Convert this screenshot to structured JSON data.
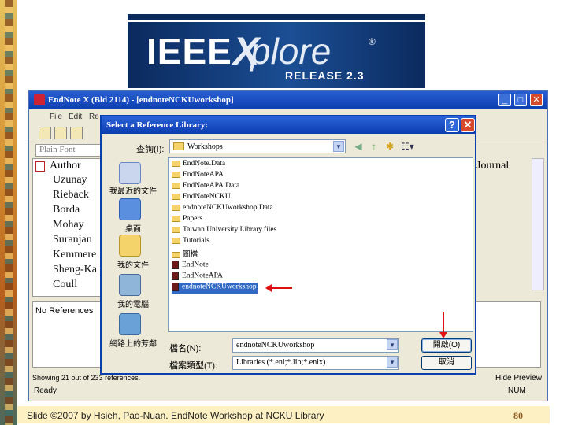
{
  "slide": {
    "footer": "Slide ©2007 by Hsieh, Pao-Nuan. EndNote Workshop at NCKU Library",
    "page_number": "80"
  },
  "banner": {
    "word1": "IEEE",
    "word2": "X",
    "word3": "plore",
    "reg": "®",
    "release": "RELEASE 2.3"
  },
  "endnote": {
    "title": "EndNote X (Bld 2114) - [endnoteNCKUworkshop]",
    "menu": [
      "File",
      "Edit",
      "Re"
    ],
    "font_box": "Plain Font",
    "author_header": "Author",
    "authors": [
      "Uzunay",
      "Rieback",
      "Borda",
      "Mohay",
      "Suranjan",
      "Kemmere",
      "Sheng-Ka",
      "Coull"
    ],
    "journal_header": "Journal",
    "no_references": "No References",
    "showing": "Showing 21 out of 233 references.",
    "status": "Ready",
    "hide_preview": "Hide Preview",
    "num_indicator": "NUM"
  },
  "dialog": {
    "title": "Select a Reference Library:",
    "help": "?",
    "close": "✕",
    "look_in_label": "查詢(I):",
    "look_in_value": "Workshops",
    "places": [
      {
        "label": "我最近的文件",
        "icon": "recent-documents-icon"
      },
      {
        "label": "桌面",
        "icon": "desktop-icon"
      },
      {
        "label": "我的文件",
        "icon": "my-documents-icon"
      },
      {
        "label": "我的電腦",
        "icon": "my-computer-icon"
      },
      {
        "label": "網路上的芳鄰",
        "icon": "network-places-icon"
      }
    ],
    "files": [
      {
        "name": "EndNote.Data",
        "type": "folder"
      },
      {
        "name": "EndNoteAPA",
        "type": "folder"
      },
      {
        "name": "EndNoteAPA.Data",
        "type": "folder"
      },
      {
        "name": "EndNoteNCKU",
        "type": "folder"
      },
      {
        "name": "endnoteNCKUworkshop.Data",
        "type": "folder"
      },
      {
        "name": "Papers",
        "type": "folder"
      },
      {
        "name": "Taiwan University Library.files",
        "type": "folder"
      },
      {
        "name": "Tutorials",
        "type": "folder"
      },
      {
        "name": "圖檔",
        "type": "folder"
      },
      {
        "name": "EndNote",
        "type": "library"
      },
      {
        "name": "EndNoteAPA",
        "type": "library"
      },
      {
        "name": "endnoteNCKUworkshop",
        "type": "library",
        "selected": true
      }
    ],
    "file_name_label": "檔名(N):",
    "file_name_value": "endnoteNCKUworkshop",
    "file_type_label": "檔案類型(T):",
    "file_type_value": "Libraries (*.enl;*.lib;*.enlx)",
    "open_button": "開啟(O)",
    "cancel_button": "取消"
  },
  "colors": {
    "titlebar": "#0c3fb0",
    "selection": "#316ac5",
    "annotation_arrow": "#dd1111",
    "footer_bg": "#fdf1c4"
  }
}
